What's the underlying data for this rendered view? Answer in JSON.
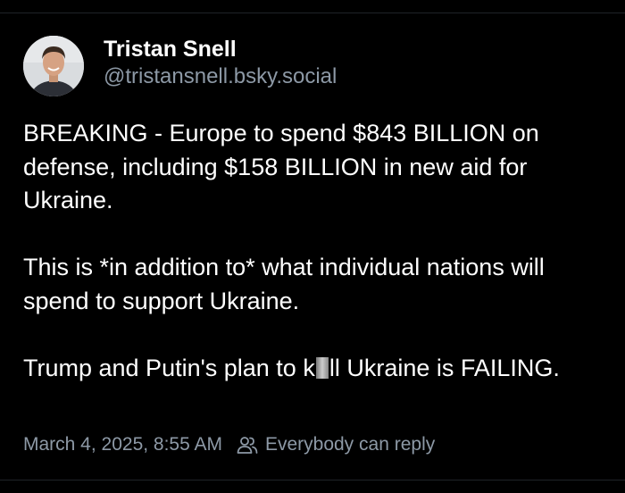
{
  "author": {
    "display_name": "Tristan Snell",
    "handle": "@tristansnell.bsky.social"
  },
  "post": {
    "paragraph_1": "BREAKING - Europe to spend $843 BILLION on defense, including $158 BILLION in new aid for Ukraine.",
    "paragraph_2": "This is *in addition to* what individual nations will spend to support Ukraine.",
    "paragraph_3_before": "Trump and Putin's plan to k",
    "paragraph_3_after": "ll Ukraine is FAILING."
  },
  "meta": {
    "timestamp": "March 4, 2025, 8:55 AM",
    "reply_setting": "Everybody can reply",
    "reply_icon": "people-icon"
  },
  "colors": {
    "background": "#000000",
    "text": "#ffffff",
    "muted": "#8d99a6"
  }
}
